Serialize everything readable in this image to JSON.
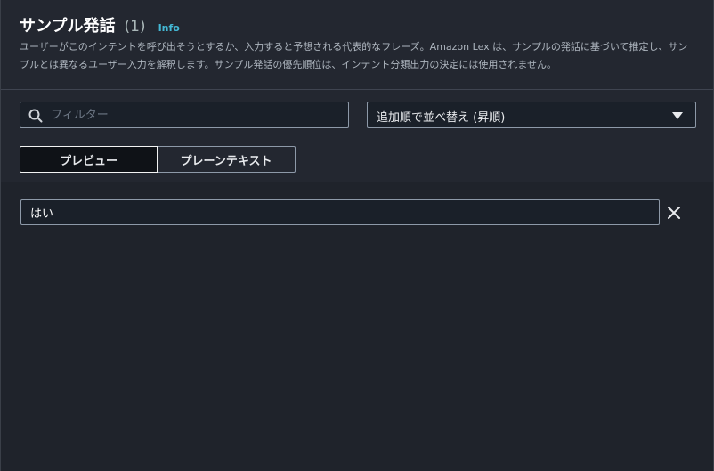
{
  "header": {
    "title": "サンプル発話",
    "count": "(1)",
    "info_label": "Info",
    "description": "ユーザーがこのインテントを呼び出そうとするか、入力すると予想される代表的なフレーズ。Amazon Lex は、サンプルの発話に基づいて推定し、サンプルとは異なるユーザー入力を解釈します。サンプル発話の優先順位は、インテント分類出力の決定には使用されません。"
  },
  "filter": {
    "placeholder": "フィルター",
    "value": "",
    "icon": "search-icon"
  },
  "sort": {
    "selected": "追加順で並べ替え (昇順)",
    "icon": "caret-down-icon"
  },
  "view_toggle": {
    "preview_label": "プレビュー",
    "plaintext_label": "プレーンテキスト",
    "active": "preview"
  },
  "utterances": [
    {
      "text": "はい",
      "remove_icon": "close-icon"
    }
  ],
  "colors": {
    "accent_link": "#44b9d6",
    "panel_bg": "#232730",
    "body_bg": "#1f232b"
  }
}
